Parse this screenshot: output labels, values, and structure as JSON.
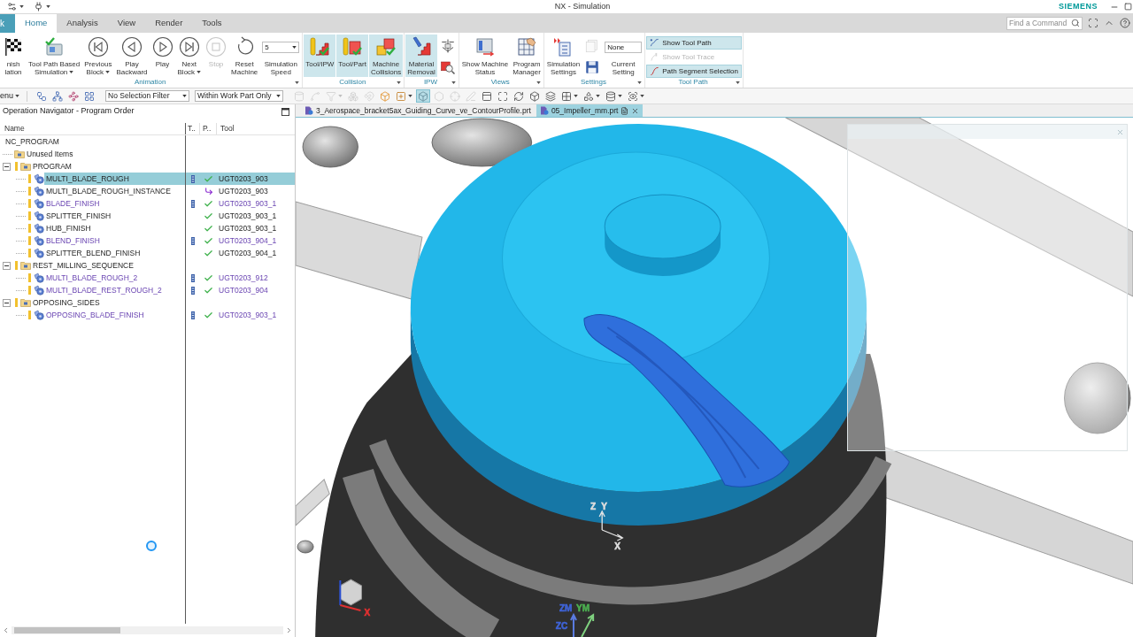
{
  "window": {
    "title": "NX - Simulation",
    "brand": "SIEMENS"
  },
  "ribbon_tabs": [
    {
      "label": "k",
      "kind": "file",
      "selected": false
    },
    {
      "label": "Home",
      "kind": "tab",
      "selected": true
    },
    {
      "label": "Analysis",
      "kind": "tab",
      "selected": false
    },
    {
      "label": "View",
      "kind": "tab",
      "selected": false
    },
    {
      "label": "Render",
      "kind": "tab",
      "selected": false
    },
    {
      "label": "Tools",
      "kind": "tab",
      "selected": false
    }
  ],
  "command_search": {
    "placeholder": "Find a Command"
  },
  "ribbon_groups": [
    {
      "label": "Animation",
      "launcher": true,
      "commands": [
        {
          "kind": "large",
          "lines": [
            "nish",
            "lation"
          ],
          "dropdown": false,
          "selected": false,
          "disabled": false
        },
        {
          "kind": "large",
          "lines": [
            "Tool Path Based",
            "Simulation"
          ],
          "dropdown": true,
          "selected": false,
          "disabled": false
        },
        {
          "kind": "large",
          "lines": [
            "Previous",
            "Block"
          ],
          "dropdown": true,
          "selected": false,
          "disabled": false
        },
        {
          "kind": "large",
          "lines": [
            "Play",
            "Backward"
          ],
          "dropdown": false,
          "selected": false,
          "disabled": false
        },
        {
          "kind": "large",
          "lines": [
            "Play"
          ],
          "dropdown": false,
          "selected": false,
          "disabled": false
        },
        {
          "kind": "large",
          "lines": [
            "Next",
            "Block"
          ],
          "dropdown": true,
          "selected": false,
          "disabled": false
        },
        {
          "kind": "large",
          "lines": [
            "Stop"
          ],
          "dropdown": false,
          "selected": false,
          "disabled": true
        },
        {
          "kind": "large",
          "lines": [
            "Reset",
            "Machine"
          ],
          "dropdown": false,
          "selected": false,
          "disabled": false
        },
        {
          "kind": "field",
          "value": "5",
          "dropdown": true,
          "lines": [
            "Simulation",
            "Speed"
          ]
        }
      ]
    },
    {
      "label": "Collision",
      "launcher": true,
      "commands": [
        {
          "kind": "large",
          "lines": [
            "Tool/IPW"
          ],
          "dropdown": false,
          "selected": true,
          "disabled": false
        },
        {
          "kind": "large",
          "lines": [
            "Tool/Part"
          ],
          "dropdown": false,
          "selected": true,
          "disabled": false
        },
        {
          "kind": "large",
          "lines": [
            "Machine",
            "Collisions"
          ],
          "dropdown": false,
          "selected": true,
          "disabled": false
        }
      ]
    },
    {
      "label": "IPW",
      "launcher": true,
      "commands": [
        {
          "kind": "large",
          "lines": [
            "Material",
            "Removal"
          ],
          "dropdown": false,
          "selected": true,
          "disabled": false
        },
        {
          "kind": "stack",
          "items": [
            {
              "disabled": false
            },
            {
              "disabled": false
            }
          ]
        }
      ]
    },
    {
      "label": "Views",
      "launcher": true,
      "commands": [
        {
          "kind": "large",
          "lines": [
            "Show Machine",
            "Status"
          ],
          "dropdown": false,
          "selected": false,
          "disabled": false
        },
        {
          "kind": "large",
          "lines": [
            "Program",
            "Manager"
          ],
          "dropdown": false,
          "selected": false,
          "disabled": false
        }
      ]
    },
    {
      "label": "Settings",
      "launcher": true,
      "commands": [
        {
          "kind": "large",
          "lines": [
            "Simulation",
            "Settings"
          ],
          "dropdown": false,
          "selected": false,
          "disabled": false
        },
        {
          "kind": "stack",
          "items": [
            {
              "disabled": true
            },
            {
              "disabled": false
            }
          ]
        },
        {
          "kind": "field",
          "value": "None",
          "dropdown": false,
          "lines": [
            "Current",
            "Setting"
          ]
        }
      ]
    },
    {
      "label": "Tool Path",
      "launcher": true,
      "commands": [
        {
          "kind": "rows",
          "items": [
            {
              "label": "Show Tool Path",
              "selected": true,
              "disabled": false
            },
            {
              "label": "Show Tool Trace",
              "selected": false,
              "disabled": true
            },
            {
              "label": "Path Segment Selection",
              "selected": true,
              "disabled": false
            }
          ]
        }
      ]
    }
  ],
  "menu_button": {
    "label": "enu"
  },
  "selection_filters": [
    {
      "value": "No Selection Filter"
    },
    {
      "value": "Within Work Part Only"
    }
  ],
  "view_toolbar": [
    {
      "selected": false,
      "disabled": false,
      "dropdown": false
    },
    {
      "selected": false,
      "disabled": false,
      "dropdown": false
    },
    {
      "selected": false,
      "disabled": false,
      "dropdown": false
    },
    {
      "selected": false,
      "disabled": false,
      "dropdown": false
    },
    {
      "selected": false,
      "disabled": true,
      "dropdown": false
    },
    {
      "selected": false,
      "disabled": true,
      "dropdown": false
    },
    {
      "selected": false,
      "disabled": true,
      "dropdown": true
    },
    {
      "selected": false,
      "disabled": true,
      "dropdown": false
    },
    {
      "selected": false,
      "disabled": true,
      "dropdown": false
    },
    {
      "selected": false,
      "disabled": false,
      "dropdown": false
    },
    {
      "selected": false,
      "disabled": false,
      "dropdown": true
    },
    {
      "selected": true,
      "disabled": false,
      "dropdown": false
    },
    {
      "selected": false,
      "disabled": true,
      "dropdown": false
    },
    {
      "selected": false,
      "disabled": true,
      "dropdown": false
    },
    {
      "selected": false,
      "disabled": true,
      "dropdown": false
    },
    {
      "selected": false,
      "disabled": false,
      "dropdown": false
    },
    {
      "selected": false,
      "disabled": false,
      "dropdown": false
    },
    {
      "selected": false,
      "disabled": false,
      "dropdown": false
    },
    {
      "selected": false,
      "disabled": false,
      "dropdown": false
    },
    {
      "selected": false,
      "disabled": false,
      "dropdown": false
    },
    {
      "selected": false,
      "disabled": false,
      "dropdown": true
    },
    {
      "selected": false,
      "disabled": false,
      "dropdown": true
    },
    {
      "selected": false,
      "disabled": false,
      "dropdown": true
    },
    {
      "selected": false,
      "disabled": false,
      "dropdown": true
    }
  ],
  "navigator": {
    "title": "Operation Navigator - Program Order",
    "columns": [
      "Name",
      "T..",
      "P..",
      "Tool"
    ],
    "tree": [
      {
        "name": "NC_PROGRAM",
        "flag": false,
        "selected": false,
        "children": [
          {
            "name": "Unused Items",
            "kind": "group",
            "flag": false,
            "selected": false
          },
          {
            "name": "PROGRAM",
            "kind": "group",
            "flag": true,
            "expanded": true,
            "selected": false,
            "children": [
              {
                "name": "MULTI_BLADE_ROUGH",
                "kind": "operation",
                "flag": true,
                "selected": true,
                "highlighted": false,
                "t_marker": true,
                "complete": true,
                "linked": false,
                "tool": "UGT0203_903"
              },
              {
                "name": "MULTI_BLADE_ROUGH_INSTANCE",
                "kind": "operation",
                "flag": true,
                "selected": false,
                "highlighted": false,
                "t_marker": false,
                "complete": false,
                "linked": true,
                "tool": "UGT0203_903"
              },
              {
                "name": "BLADE_FINISH",
                "kind": "operation",
                "flag": true,
                "selected": false,
                "highlighted": true,
                "t_marker": true,
                "complete": true,
                "linked": false,
                "tool": "UGT0203_903_1"
              },
              {
                "name": "SPLITTER_FINISH",
                "kind": "operation",
                "flag": true,
                "selected": false,
                "highlighted": false,
                "t_marker": false,
                "complete": true,
                "linked": false,
                "tool": "UGT0203_903_1"
              },
              {
                "name": "HUB_FINISH",
                "kind": "operation",
                "flag": true,
                "selected": false,
                "highlighted": false,
                "t_marker": false,
                "complete": true,
                "linked": false,
                "tool": "UGT0203_903_1"
              },
              {
                "name": "BLEND_FINISH",
                "kind": "operation",
                "flag": true,
                "selected": false,
                "highlighted": true,
                "t_marker": true,
                "complete": true,
                "linked": false,
                "tool": "UGT0203_904_1"
              },
              {
                "name": "SPLITTER_BLEND_FINISH",
                "kind": "operation",
                "flag": true,
                "selected": false,
                "highlighted": false,
                "t_marker": false,
                "complete": true,
                "linked": false,
                "tool": "UGT0203_904_1"
              }
            ]
          },
          {
            "name": "REST_MILLING_SEQUENCE",
            "kind": "group",
            "flag": true,
            "expanded": true,
            "selected": false,
            "children": [
              {
                "name": "MULTI_BLADE_ROUGH_2",
                "kind": "operation",
                "flag": true,
                "selected": false,
                "highlighted": true,
                "t_marker": true,
                "complete": true,
                "linked": false,
                "tool": "UGT0203_912"
              },
              {
                "name": "MULTI_BLADE_REST_ROUGH_2",
                "kind": "operation",
                "flag": true,
                "selected": false,
                "highlighted": true,
                "t_marker": true,
                "complete": true,
                "linked": false,
                "tool": "UGT0203_904"
              }
            ]
          },
          {
            "name": "OPPOSING_SIDES",
            "kind": "group",
            "flag": true,
            "expanded": true,
            "selected": false,
            "children": [
              {
                "name": "OPPOSING_BLADE_FINISH",
                "kind": "operation",
                "flag": true,
                "selected": false,
                "highlighted": true,
                "t_marker": true,
                "complete": true,
                "linked": false,
                "tool": "UGT0203_903_1"
              }
            ]
          }
        ]
      }
    ]
  },
  "document_tabs": [
    {
      "label": "3_Aerospace_bracket5ax_Guiding_Curve_ve_ContourProfile.prt",
      "selected": false
    },
    {
      "label": "05_Impeller_mm.prt",
      "selected": true
    }
  ],
  "viewport": {
    "axis_labels": [
      {
        "text": "Z",
        "color": "#dddddd"
      },
      {
        "text": "Y",
        "color": "#dddddd"
      },
      {
        "text": "X",
        "color": "#dddddd"
      },
      {
        "text": "X",
        "color": "#e03030"
      },
      {
        "text": "ZM",
        "color": "#3f63d6"
      },
      {
        "text": "YM",
        "color": "#4caf50"
      },
      {
        "text": "ZC",
        "color": "#3f63d6"
      }
    ]
  }
}
